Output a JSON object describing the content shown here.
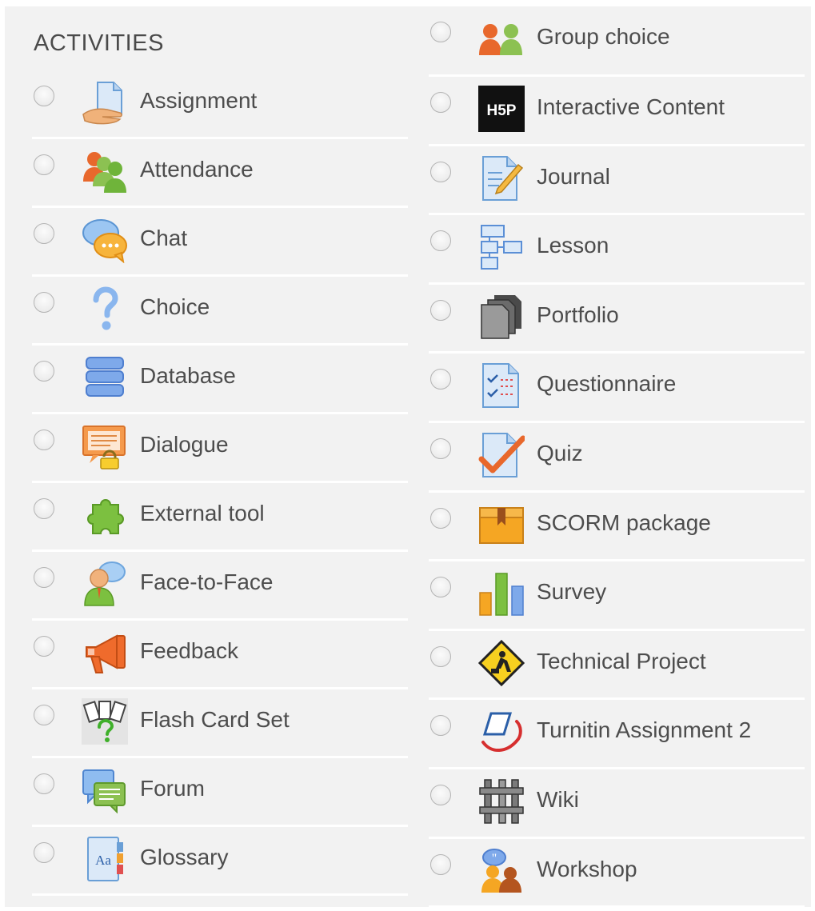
{
  "heading": "ACTIVITIES",
  "left_items": [
    {
      "label": "Assignment",
      "icon": "assignment-icon"
    },
    {
      "label": "Attendance",
      "icon": "attendance-icon"
    },
    {
      "label": "Chat",
      "icon": "chat-icon"
    },
    {
      "label": "Choice",
      "icon": "choice-icon"
    },
    {
      "label": "Database",
      "icon": "database-icon"
    },
    {
      "label": "Dialogue",
      "icon": "dialogue-icon"
    },
    {
      "label": "External tool",
      "icon": "external-tool-icon"
    },
    {
      "label": "Face-to-Face",
      "icon": "face-to-face-icon"
    },
    {
      "label": "Feedback",
      "icon": "feedback-icon"
    },
    {
      "label": "Flash Card Set",
      "icon": "flash-card-set-icon"
    },
    {
      "label": "Forum",
      "icon": "forum-icon"
    },
    {
      "label": "Glossary",
      "icon": "glossary-icon"
    }
  ],
  "right_items": [
    {
      "label": "Group choice",
      "icon": "group-choice-icon"
    },
    {
      "label": "Interactive Content",
      "icon": "h5p-icon"
    },
    {
      "label": "Journal",
      "icon": "journal-icon"
    },
    {
      "label": "Lesson",
      "icon": "lesson-icon"
    },
    {
      "label": "Portfolio",
      "icon": "portfolio-icon"
    },
    {
      "label": "Questionnaire",
      "icon": "questionnaire-icon"
    },
    {
      "label": "Quiz",
      "icon": "quiz-icon"
    },
    {
      "label": "SCORM package",
      "icon": "scorm-package-icon"
    },
    {
      "label": "Survey",
      "icon": "survey-icon"
    },
    {
      "label": "Technical Project",
      "icon": "technical-project-icon"
    },
    {
      "label": "Turnitin Assignment 2",
      "icon": "turnitin-icon"
    },
    {
      "label": "Wiki",
      "icon": "wiki-icon"
    },
    {
      "label": "Workshop",
      "icon": "workshop-icon"
    }
  ],
  "icon_text": {
    "h5p": "H5P",
    "glossary": "Aa"
  },
  "colors": {
    "panel_background": "#f2f2f2",
    "separator": "#ffffff",
    "label_text": "#4d4d4d"
  }
}
